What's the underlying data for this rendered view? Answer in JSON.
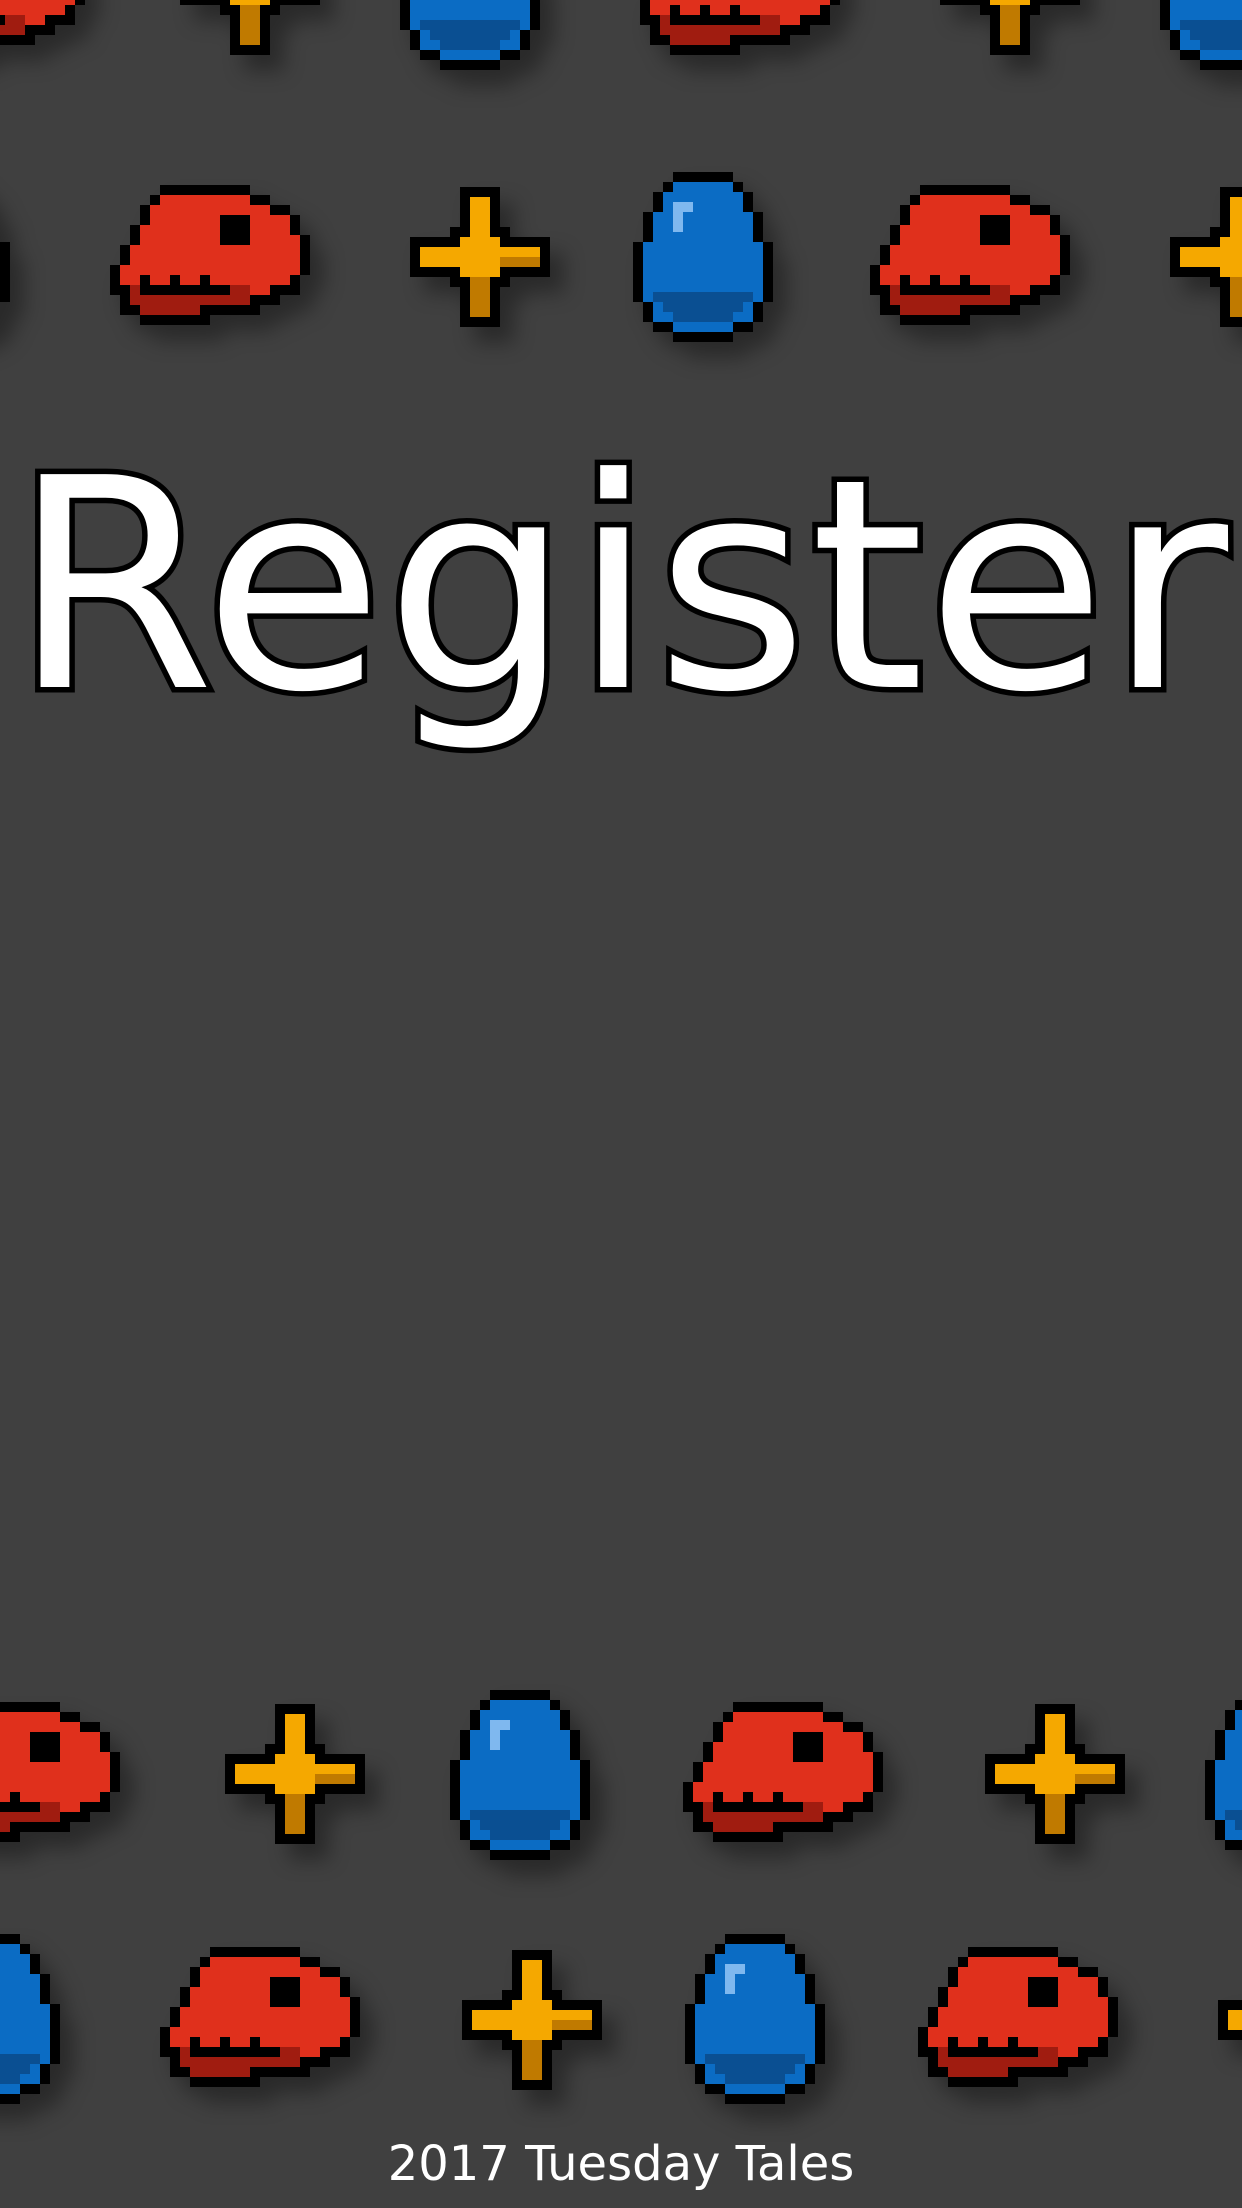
{
  "screen": {
    "title": "Register",
    "footer": "2017 Tuesday Tales"
  },
  "theme": {
    "background": "#404040",
    "title_color": "#ffffff",
    "title_outline": "#000000",
    "skull_color": "#e0301c",
    "skull_shade": "#a01c10",
    "star_color": "#f5a800",
    "star_shade": "#c07a00",
    "egg_color": "#0b6cc4",
    "egg_shade": "#0a4f92",
    "egg_highlight": "#7fb8ef"
  },
  "sprites": {
    "row_1": [
      "dino-skull",
      "star",
      "egg",
      "dino-skull",
      "star",
      "egg"
    ],
    "row_2": [
      "egg",
      "dino-skull",
      "star",
      "egg",
      "dino-skull",
      "star"
    ],
    "row_3": [
      "dino-skull",
      "star",
      "egg",
      "dino-skull",
      "star",
      "egg"
    ],
    "row_4": [
      "egg",
      "dino-skull",
      "star",
      "egg",
      "dino-skull",
      "star"
    ]
  }
}
